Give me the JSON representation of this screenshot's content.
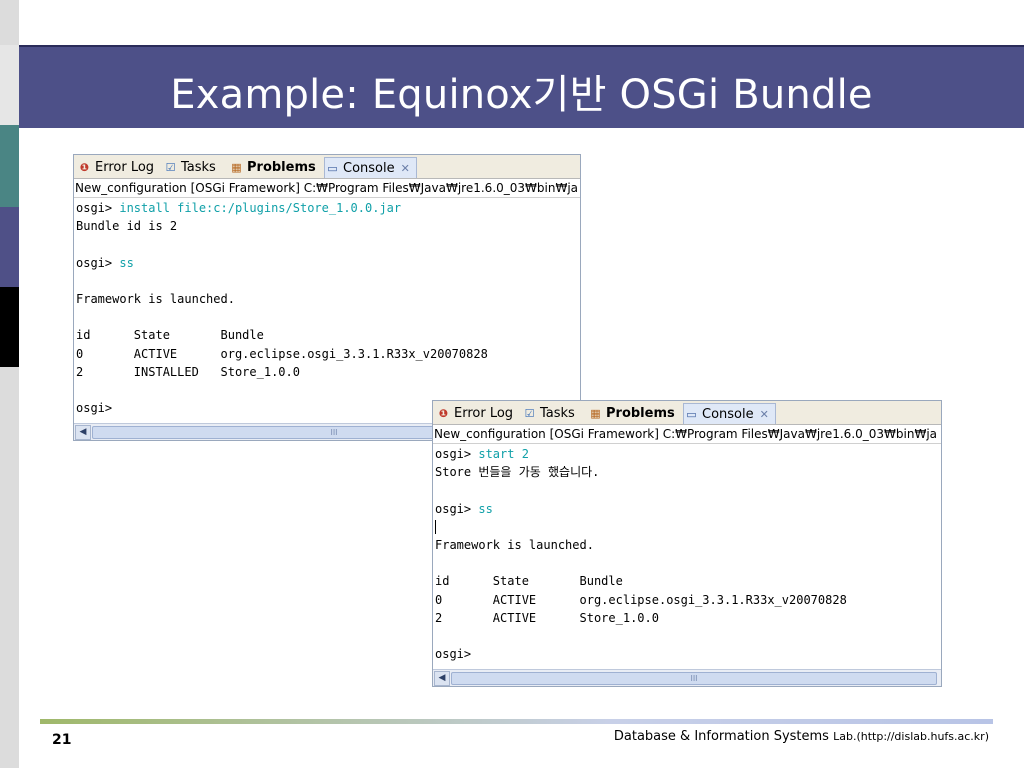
{
  "slide": {
    "title": "Example: Equinox기반 OSGi Bundle",
    "page_number": "21",
    "footer_main": "Database & Information Systems ",
    "footer_small": "Lab.(http://dislab.hufs.ac.kr)"
  },
  "tabs": [
    {
      "label": "Error Log",
      "icon": "error-log-icon"
    },
    {
      "label": "Tasks",
      "icon": "tasks-icon"
    },
    {
      "label": "Problems",
      "icon": "problems-icon"
    },
    {
      "label": "Console",
      "icon": "console-icon"
    }
  ],
  "panel1": {
    "description": "New_configuration [OSGi Framework] C:₩Program Files₩Java₩jre1.6.0_03₩bin₩ja",
    "lines": [
      {
        "prompt": "osgi> ",
        "cmd": "install file:c:/plugins/Store_1.0.0.jar"
      },
      {
        "text": "Bundle id is 2"
      },
      {
        "text": ""
      },
      {
        "prompt": "osgi> ",
        "cmd": "ss"
      },
      {
        "text": ""
      },
      {
        "text": "Framework is launched."
      },
      {
        "text": ""
      },
      {
        "text": "id      State       Bundle"
      },
      {
        "text": "0       ACTIVE      org.eclipse.osgi_3.3.1.R33x_v20070828"
      },
      {
        "text": "2       INSTALLED   Store_1.0.0"
      },
      {
        "text": ""
      },
      {
        "prompt": "osgi>",
        "cmd": ""
      }
    ]
  },
  "panel2": {
    "description": "New_configuration [OSGi Framework] C:₩Program Files₩Java₩jre1.6.0_03₩bin₩ja",
    "lines": [
      {
        "prompt": "osgi> ",
        "cmd": "start 2"
      },
      {
        "text": "Store 번들을 가동 했습니다."
      },
      {
        "text": ""
      },
      {
        "prompt": "osgi> ",
        "cmd": "ss"
      },
      {
        "text": ""
      },
      {
        "text": "Framework is launched."
      },
      {
        "text": ""
      },
      {
        "text": "id      State       Bundle"
      },
      {
        "text": "0       ACTIVE      org.eclipse.osgi_3.3.1.R33x_v20070828"
      },
      {
        "text": "2       ACTIVE      Store_1.0.0"
      },
      {
        "text": ""
      },
      {
        "prompt": "osgi>",
        "cmd": ""
      }
    ]
  },
  "scrollbar": {
    "thumb_grip": "III",
    "left_arrow": "◀"
  }
}
